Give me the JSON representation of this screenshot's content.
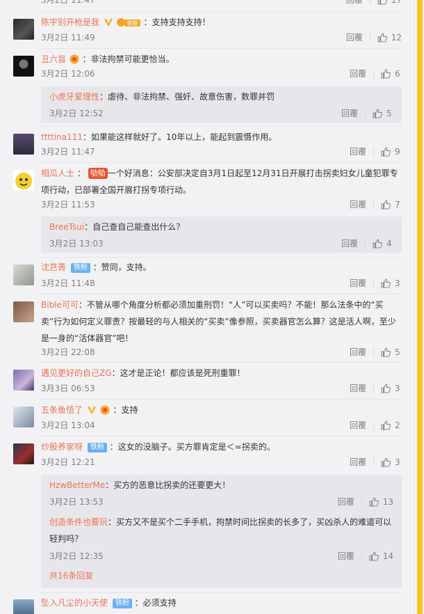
{
  "ui": {
    "reply_label": "回覆",
    "fan_badge": "铁粉",
    "vip_badge_text": "铁粉",
    "accent_color": "#eb7350",
    "fan_badge_color": "#6cb2f3",
    "scrollbar_color": "#fbc21a"
  },
  "top_partial": {
    "time": "3月2日 11:47",
    "likes": "17"
  },
  "comments": [
    {
      "user": "陈宇别开枪是我",
      "text": "：支持支持支持！",
      "time": "3月2日 11:49",
      "likes": "12"
    },
    {
      "user": "丑六盲",
      "text": "：非法拘禁可能更恰当。",
      "time": "3月2日 12:06",
      "likes": "6",
      "replies": [
        {
          "user": "小虎牙爱理性",
          "text": "：虐待、非法拘禁、强奸、故意伤害，数罪并罚",
          "time": "3月2日 12:52",
          "likes": "5"
        }
      ]
    },
    {
      "user": "ttttina111",
      "text": "：如果能这样就好了。10年以上，能起到震慑作用。",
      "time": "3月2日 11:47",
      "likes": "9"
    },
    {
      "user": "相瓜人士",
      "badge": "劬劬",
      "text": "一个好消息：公安部决定自3月1日起至12月31日开展打击拐卖妇女儿童犯罪专项行动，已部署全国开展打拐专项行动。",
      "time": "3月2日 11:53",
      "likes": "7",
      "replies": [
        {
          "user": "BreeTsui",
          "text": "：自己查自己能查出什么？",
          "time": "3月2日 13:03",
          "likes": "4"
        }
      ]
    },
    {
      "user": "沈芑菁",
      "text": "：赞同，支持。",
      "time": "3月2日 11:48",
      "likes": "3"
    },
    {
      "user": "Bible可可",
      "text": "：不管从哪个角度分析都必须加重刑罚！“人”可以买卖吗？不能！那么法条中的“买卖”行为如何定义罪责？按最轻的与人相关的“买卖”像参照，买卖器官怎么算？这是活人啊，至少是一身的“活体器官”吧！",
      "time": "3月2日 22:08",
      "likes": "5"
    },
    {
      "user": "遇见更好的自己ZG",
      "text": "：这才是正论！都应该是死刑重罪！",
      "time": "3月3日 06:53",
      "likes": "3"
    },
    {
      "user": "五条鱼悟了",
      "text": "：支持",
      "time": "3月2日 13:04",
      "likes": "2"
    },
    {
      "user": "炒股养家呀",
      "text": "：这女的没脑子。买方罪肯定是＜=拐卖的。",
      "time": "3月2日 12:21",
      "likes": "3",
      "replies": [
        {
          "user": "HzwBetterMe",
          "text": "：买方的恶意比拐卖的还要更大！",
          "time": "3月2日 13:53",
          "likes": "13"
        },
        {
          "user": "创造条件也要玩",
          "text": "：买方又不是买个二手手机，拘禁时间比拐卖的长多了，买凶杀人的难道可以轻判吗？",
          "time": "3月2日 12:35",
          "likes": "14"
        }
      ],
      "more": "共16条回复"
    },
    {
      "user": "坠入凡尘的小天使",
      "text": "：必须支持"
    }
  ]
}
